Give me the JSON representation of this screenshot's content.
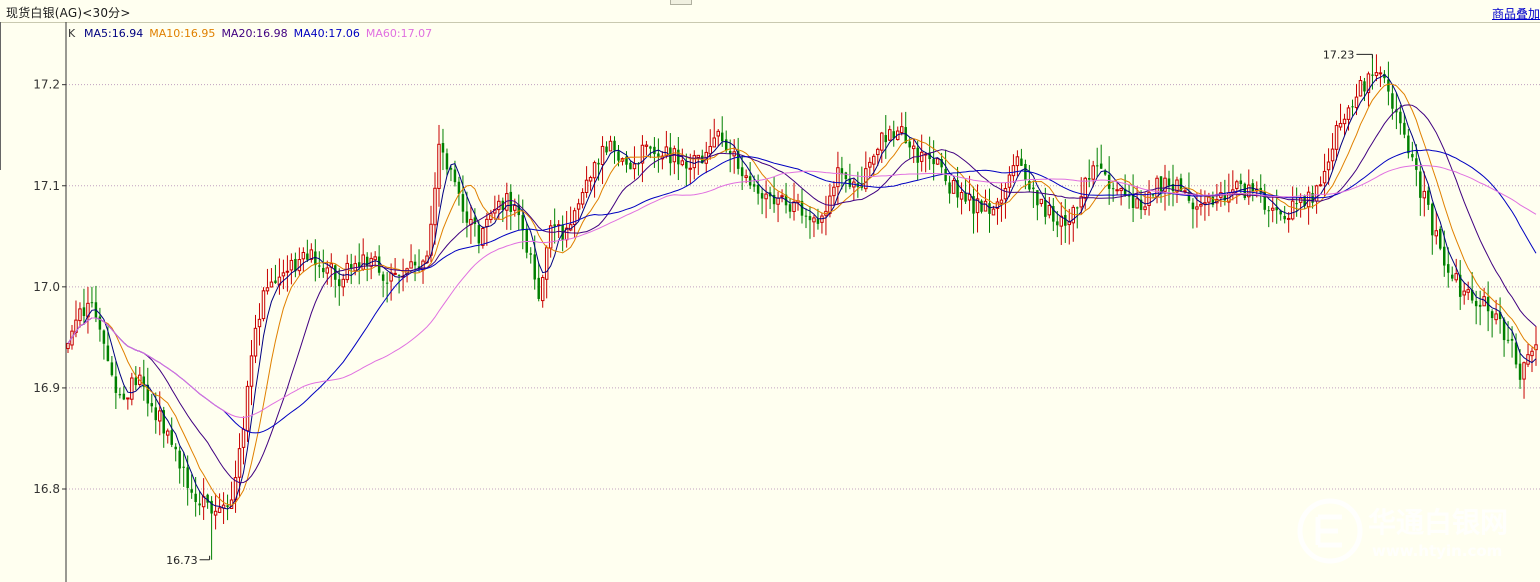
{
  "header": {
    "title": "现货白银(AG)<30分>",
    "right_link": "商品叠加"
  },
  "watermark": {
    "brand": "华通白银网",
    "url": "www.htyin.com"
  },
  "chart_data": {
    "type": "candlestick",
    "title": "现货白银(AG)<30分>",
    "legend_label": "K",
    "ma_legend": [
      {
        "name": "MA5",
        "value": 16.94,
        "color": "#000080",
        "text": "MA5:16.94"
      },
      {
        "name": "MA10",
        "value": 16.95,
        "color": "#e08000",
        "text": "MA10:16.95"
      },
      {
        "name": "MA20",
        "value": 16.98,
        "color": "#400080",
        "text": "MA20:16.98"
      },
      {
        "name": "MA40",
        "value": 17.06,
        "color": "#0000c0",
        "text": "MA40:17.06"
      },
      {
        "name": "MA60",
        "value": 17.07,
        "color": "#e070e0",
        "text": "MA60:17.07"
      }
    ],
    "y_ticks": [
      "17.2",
      "17.1",
      "17.0",
      "16.9",
      "16.8"
    ],
    "y_tick_values": [
      17.2,
      17.1,
      17.0,
      16.9,
      16.8
    ],
    "ylim": [
      16.708,
      17.262
    ],
    "grid": true,
    "high_label": {
      "text": "17.23",
      "value": 17.23
    },
    "low_label": {
      "text": "16.73",
      "value": 16.73
    },
    "anchors": [
      [
        0,
        16.94
      ],
      [
        5,
        16.99
      ],
      [
        8,
        16.96
      ],
      [
        12,
        16.89
      ],
      [
        18,
        16.91
      ],
      [
        24,
        16.86
      ],
      [
        30,
        16.81
      ],
      [
        36,
        16.77
      ],
      [
        41,
        16.79
      ],
      [
        44,
        16.86
      ],
      [
        47,
        16.96
      ],
      [
        50,
        17.0
      ],
      [
        56,
        17.02
      ],
      [
        62,
        17.03
      ],
      [
        68,
        17.01
      ],
      [
        74,
        17.03
      ],
      [
        80,
        17.01
      ],
      [
        86,
        17.02
      ],
      [
        90,
        17.03
      ],
      [
        93,
        17.14
      ],
      [
        96,
        17.11
      ],
      [
        99,
        17.08
      ],
      [
        103,
        17.05
      ],
      [
        107,
        17.07
      ],
      [
        110,
        17.09
      ],
      [
        114,
        17.06
      ],
      [
        118,
        16.99
      ],
      [
        121,
        17.07
      ],
      [
        125,
        17.05
      ],
      [
        130,
        17.11
      ],
      [
        136,
        17.14
      ],
      [
        141,
        17.12
      ],
      [
        146,
        17.14
      ],
      [
        152,
        17.13
      ],
      [
        157,
        17.12
      ],
      [
        162,
        17.15
      ],
      [
        167,
        17.13
      ],
      [
        172,
        17.1
      ],
      [
        178,
        17.09
      ],
      [
        183,
        17.08
      ],
      [
        188,
        17.06
      ],
      [
        193,
        17.11
      ],
      [
        198,
        17.1
      ],
      [
        203,
        17.14
      ],
      [
        208,
        17.16
      ],
      [
        213,
        17.13
      ],
      [
        218,
        17.12
      ],
      [
        223,
        17.09
      ],
      [
        228,
        17.08
      ],
      [
        233,
        17.08
      ],
      [
        238,
        17.12
      ],
      [
        243,
        17.09
      ],
      [
        248,
        17.06
      ],
      [
        253,
        17.08
      ],
      [
        258,
        17.13
      ],
      [
        263,
        17.09
      ],
      [
        268,
        17.08
      ],
      [
        273,
        17.1
      ],
      [
        278,
        17.1
      ],
      [
        283,
        17.07
      ],
      [
        288,
        17.09
      ],
      [
        293,
        17.1
      ],
      [
        298,
        17.09
      ],
      [
        303,
        17.07
      ],
      [
        308,
        17.08
      ],
      [
        313,
        17.09
      ],
      [
        318,
        17.15
      ],
      [
        323,
        17.19
      ],
      [
        328,
        17.22
      ],
      [
        333,
        17.17
      ],
      [
        338,
        17.11
      ],
      [
        342,
        17.06
      ],
      [
        346,
        17.02
      ],
      [
        350,
        16.99
      ],
      [
        355,
        16.99
      ],
      [
        359,
        16.96
      ],
      [
        362,
        16.95
      ],
      [
        364,
        16.9
      ],
      [
        366,
        16.93
      ],
      [
        368,
        16.95
      ]
    ],
    "candle_count": 369
  }
}
